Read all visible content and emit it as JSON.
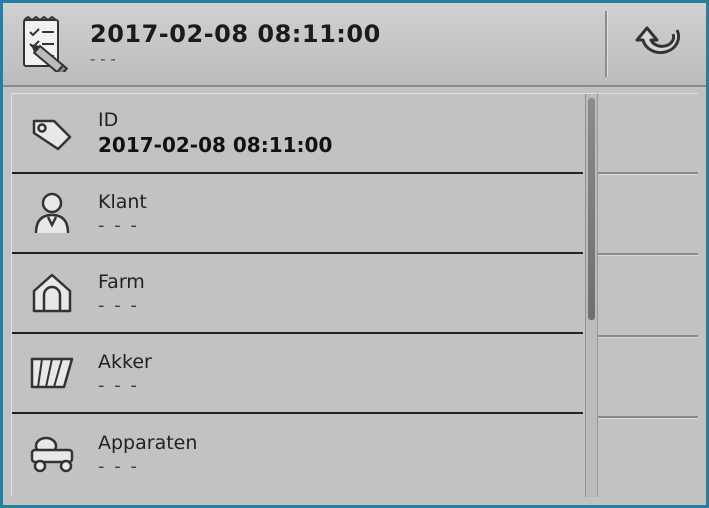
{
  "header": {
    "title": "2017-02-08 08:11:00",
    "subtitle": "- - -"
  },
  "rows": [
    {
      "label": "ID",
      "value": "2017-02-08 08:11:00",
      "blank": false
    },
    {
      "label": "Klant",
      "value": "- - -",
      "blank": true
    },
    {
      "label": "Farm",
      "value": "- - -",
      "blank": true
    },
    {
      "label": "Akker",
      "value": "- - -",
      "blank": true
    },
    {
      "label": "Apparaten",
      "value": "- - -",
      "blank": true
    }
  ]
}
